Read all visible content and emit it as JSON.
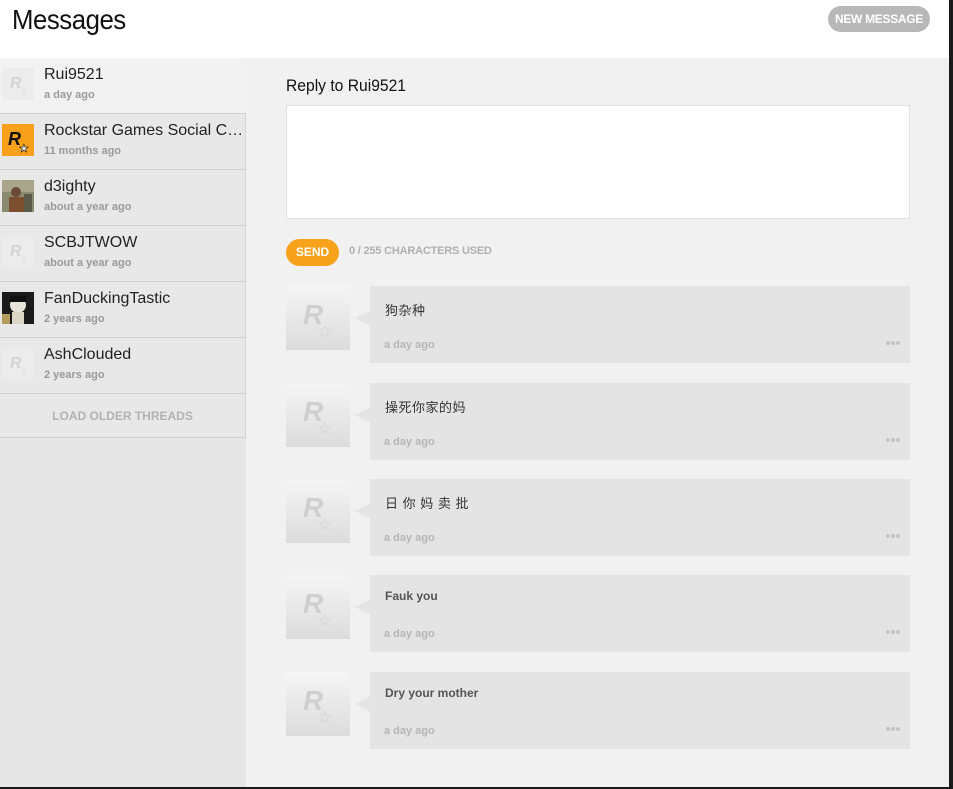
{
  "header": {
    "title": "Messages",
    "new_message_label": "NEW MESSAGE"
  },
  "sidebar": {
    "threads": [
      {
        "name": "Rui9521",
        "time": "a day ago",
        "avatar": "rockstar-placeholder-icon"
      },
      {
        "name": "Rockstar Games Social Club",
        "time": "11 months ago",
        "avatar": "rockstar-logo-icon"
      },
      {
        "name": "d3ighty",
        "time": "about a year ago",
        "avatar": "user-photo"
      },
      {
        "name": "SCBJTWOW",
        "time": "about a year ago",
        "avatar": "rockstar-placeholder-icon"
      },
      {
        "name": "FanDuckingTastic",
        "time": "2 years ago",
        "avatar": "user-photo"
      },
      {
        "name": "AshClouded",
        "time": "2 years ago",
        "avatar": "rockstar-placeholder-icon"
      }
    ],
    "load_older_label": "LOAD OLDER THREADS"
  },
  "reply": {
    "title": "Reply to Rui9521",
    "value": "",
    "send_label": "SEND",
    "char_count": "0 / 255 CHARACTERS USED"
  },
  "messages": [
    {
      "text": "狗杂种",
      "time": "a day ago"
    },
    {
      "text": "操死你家的妈",
      "time": "a day ago"
    },
    {
      "text": "日 你 妈 卖 批",
      "time": "a day ago"
    },
    {
      "text": "Fauk you",
      "time": "a day ago"
    },
    {
      "text": "Dry your mother",
      "time": "a day ago"
    }
  ],
  "colors": {
    "accent": "#f7a21b",
    "sidebar_bg": "#e6e6e6",
    "main_bg": "#f1f1f1",
    "bubble_bg": "#e4e4e4"
  }
}
